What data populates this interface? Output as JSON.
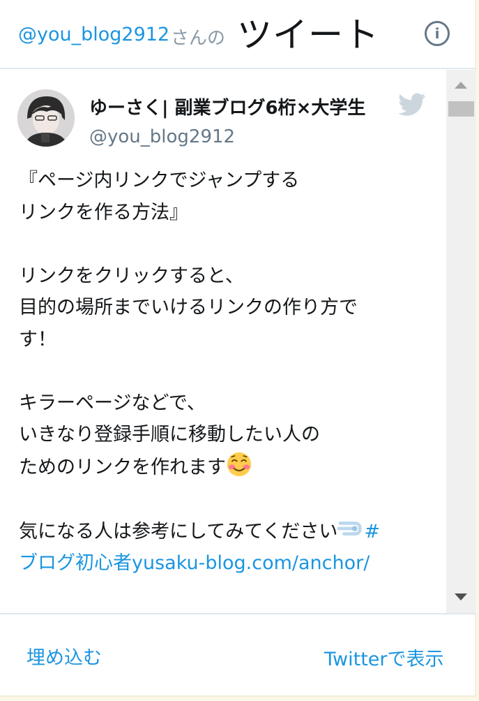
{
  "header": {
    "handle": "@you_blog2912",
    "handle_suffix": "さんの",
    "title": "ツイート",
    "info_icon": "info-icon",
    "info_glyph": "i"
  },
  "tweet": {
    "author_name": "ゆーさく| 副業ブログ6桁×大学生",
    "author_handle": "@you_blog2912",
    "avatar_icon": "avatar-image",
    "brand_icon": "twitter-bird-icon",
    "text_part1": "『ページ内リンクでジャンプする\nリンクを作る方法』\n\nリンクをクリックすると、\n目的の場所までいけるリンクの作り方で\nす！\n\nキラーページなどで、\nいきなり登録手順に移動したい人の\nためのリンクを作れます",
    "emoji1": "smiling-blushing-face-emoji",
    "text_part2": "\n\n気になる人は参考にしてみてください",
    "emoji2": "dash-emoji",
    "hashtag_char": "#",
    "link_text": "\nブログ初心者yusaku-blog.com/anchor/"
  },
  "scrollbar": {
    "up_icon": "scroll-up-arrow-icon",
    "down_icon": "scroll-down-arrow-icon"
  },
  "footer": {
    "embed_label": "埋め込む",
    "view_label": "Twitterで表示"
  },
  "colors": {
    "link": "#1b95e0",
    "text": "#14171a",
    "muted": "#657786",
    "border": "#e1e8ed"
  }
}
